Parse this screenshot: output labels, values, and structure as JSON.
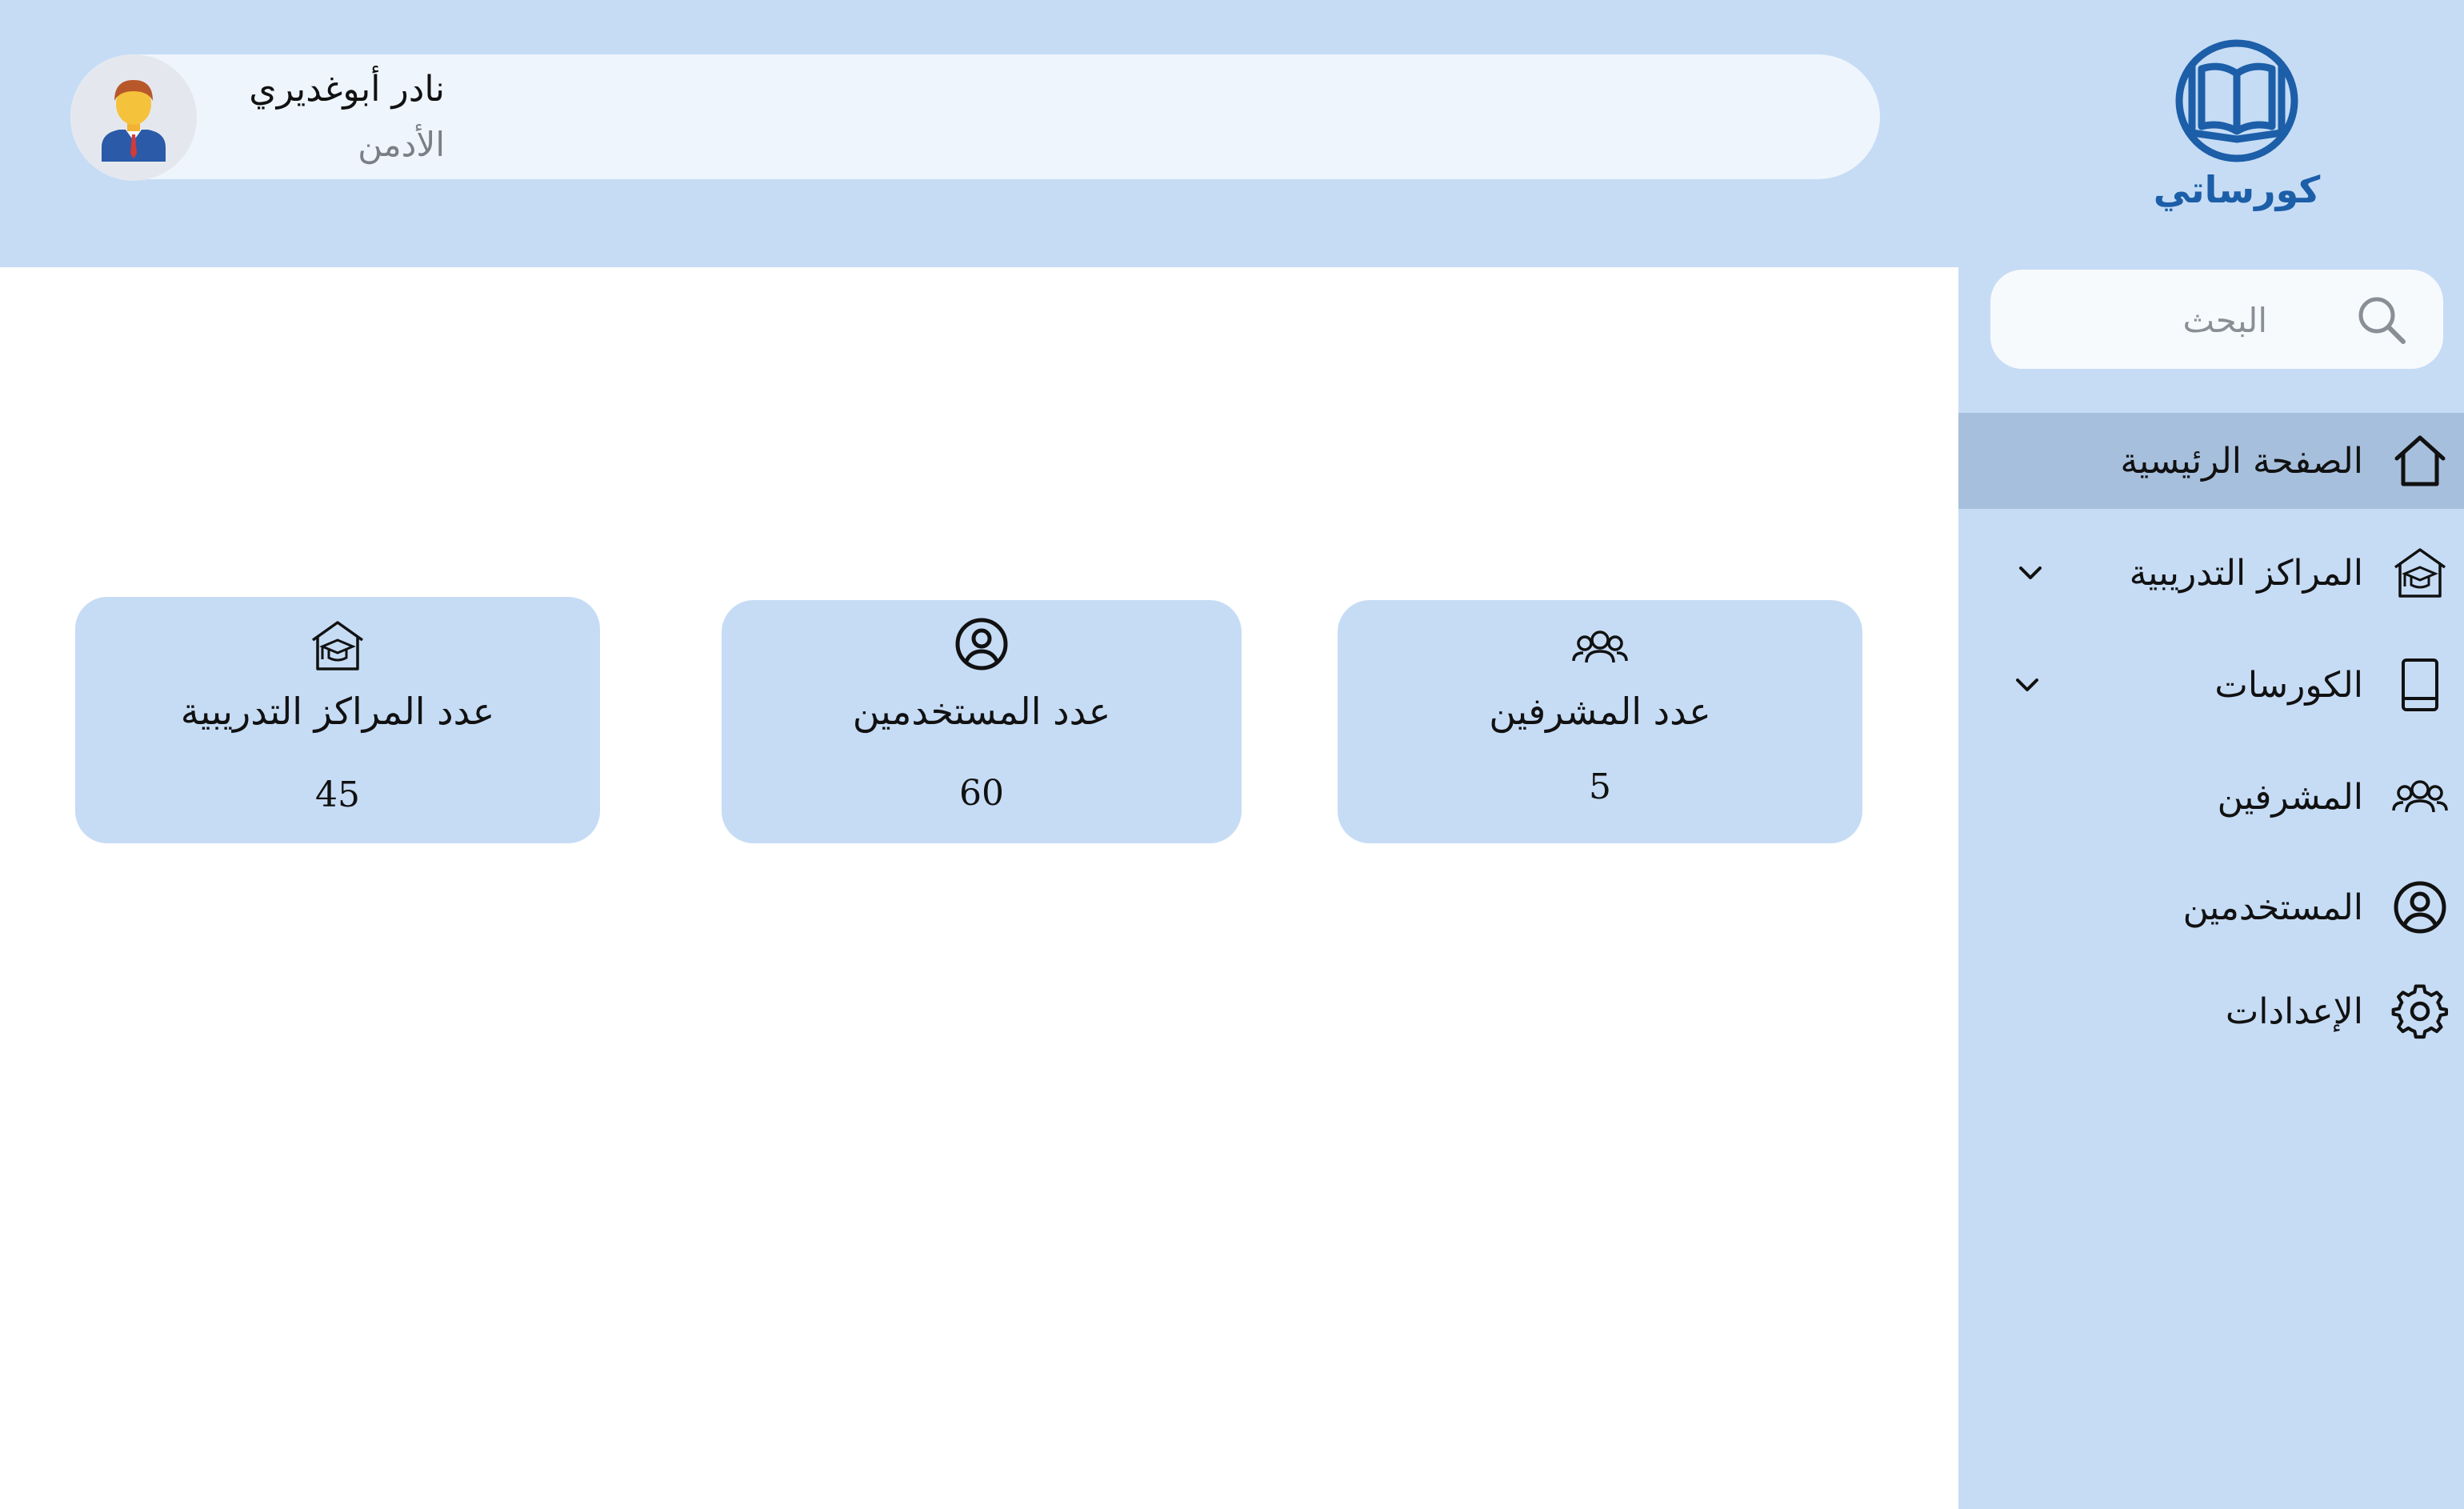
{
  "brand": {
    "name": "كورساتي",
    "logo_icon": "open-book-globe-logo",
    "color": "#1c5ea8"
  },
  "user": {
    "name": "نادر أبوغديري",
    "role": "الأدمن",
    "avatar_icon": "businessman-avatar-icon"
  },
  "search": {
    "placeholder": "البحث",
    "icon": "search-icon"
  },
  "sidebar": {
    "items": [
      {
        "label": "الصفحة الرئيسية",
        "icon": "home-icon",
        "active": true,
        "has_submenu": false
      },
      {
        "label": "المراكز التدريبية",
        "icon": "training-center-icon",
        "active": false,
        "has_submenu": true
      },
      {
        "label": "الكورسات",
        "icon": "book-icon",
        "active": false,
        "has_submenu": true
      },
      {
        "label": "المشرفين",
        "icon": "supervisors-group-icon",
        "active": false,
        "has_submenu": false
      },
      {
        "label": "المستخدمين",
        "icon": "user-circle-icon",
        "active": false,
        "has_submenu": false
      },
      {
        "label": "الإعدادات",
        "icon": "gear-icon",
        "active": false,
        "has_submenu": false
      }
    ]
  },
  "stats": [
    {
      "title": "عدد المشرفين",
      "value": "5",
      "icon": "supervisors-group-icon"
    },
    {
      "title": "عدد المستخدمين",
      "value": "60",
      "icon": "user-circle-icon"
    },
    {
      "title": "عدد المراكز التدريبية",
      "value": "45",
      "icon": "training-center-icon"
    }
  ],
  "colors": {
    "header_bg": "#c6dcf5",
    "sidebar_bg": "#c6dcf5",
    "active_item_bg": "#a6bfdc",
    "card_bg": "#c6dcf5"
  }
}
